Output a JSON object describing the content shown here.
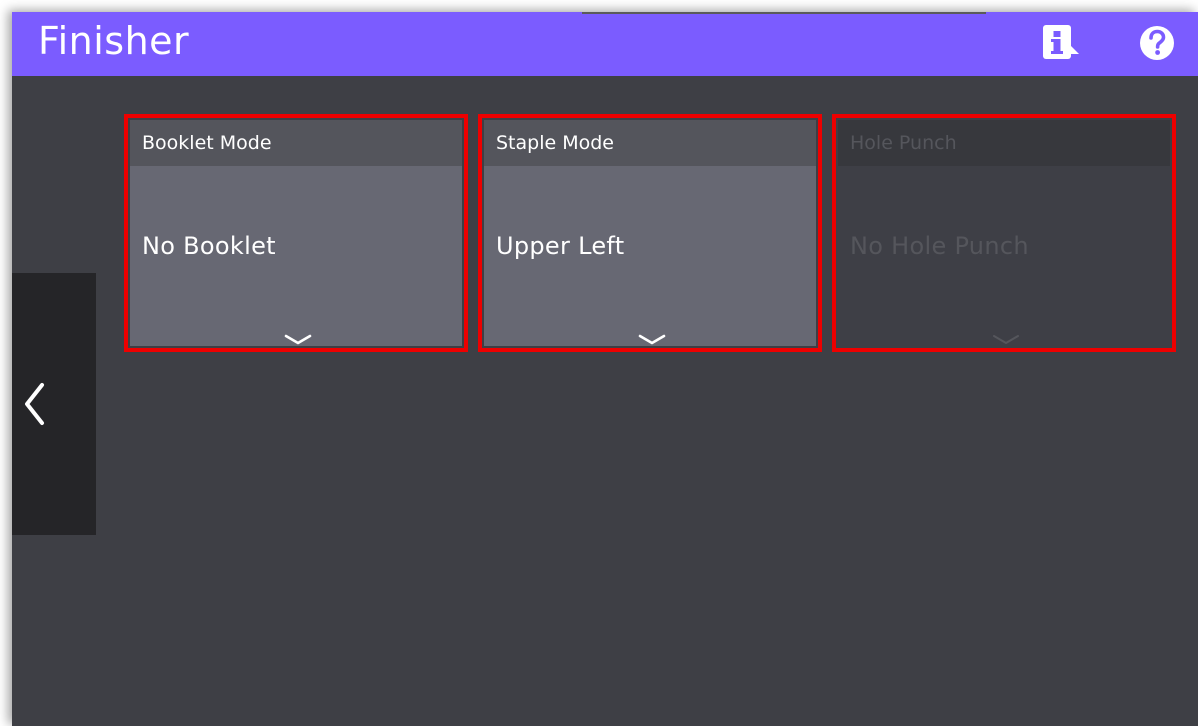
{
  "header": {
    "title": "Finisher",
    "background": "#7b5cff",
    "info_icon": "info-icon",
    "help_icon": "help-icon"
  },
  "navigation": {
    "back_icon": "chevron-left-icon"
  },
  "cards": [
    {
      "label": "Booklet Mode",
      "value": "No Booklet",
      "enabled": true,
      "icon": "chevron-down-icon"
    },
    {
      "label": "Staple Mode",
      "value": "Upper Left",
      "enabled": true,
      "icon": "chevron-down-icon"
    },
    {
      "label": "Hole Punch",
      "value": "No Hole Punch",
      "enabled": false,
      "icon": "chevron-down-icon"
    }
  ],
  "colors": {
    "highlight_border": "#ee0000",
    "screen_background": "#3e3f45",
    "card_body": "#676873",
    "card_header": "#54555c",
    "disabled_text": "#55565c"
  }
}
